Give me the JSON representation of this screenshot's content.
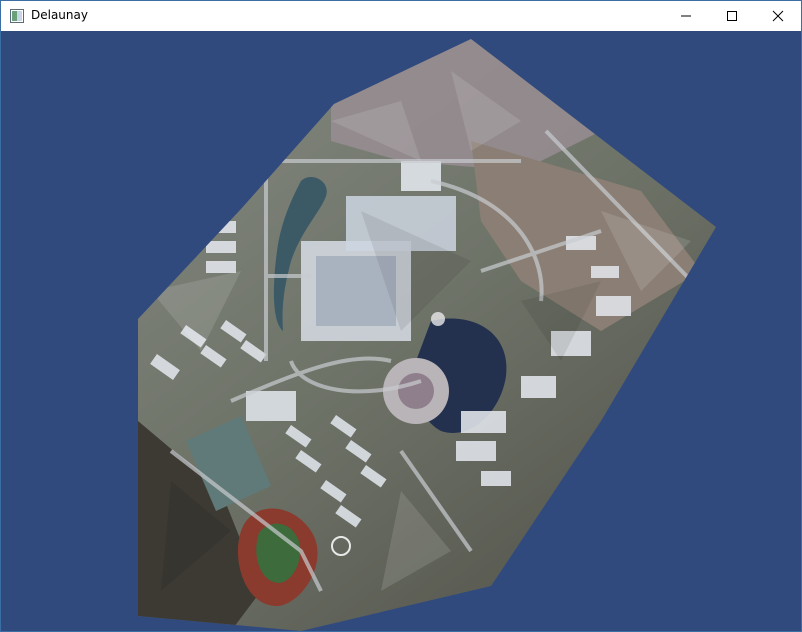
{
  "window": {
    "title": "Delaunay",
    "app_icon": "window-app-icon",
    "controls": {
      "minimize_icon": "minimize-icon",
      "maximize_icon": "maximize-icon",
      "close_icon": "close-icon"
    }
  },
  "canvas": {
    "background_color": "#314a7e",
    "content": "delaunay-triangulated-satellite-image"
  }
}
